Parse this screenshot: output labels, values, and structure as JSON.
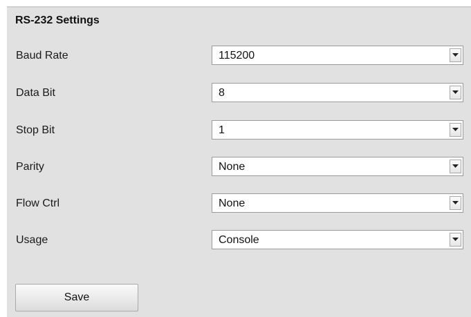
{
  "panel": {
    "title": "RS-232 Settings"
  },
  "fields": [
    {
      "label": "Baud Rate",
      "value": "115200"
    },
    {
      "label": "Data Bit",
      "value": "8"
    },
    {
      "label": "Stop Bit",
      "value": "1"
    },
    {
      "label": "Parity",
      "value": "None"
    },
    {
      "label": "Flow Ctrl",
      "value": "None"
    },
    {
      "label": "Usage",
      "value": "Console"
    }
  ],
  "actions": {
    "save_label": "Save"
  },
  "icons": {
    "dropdown": "chevron-down-icon"
  },
  "colors": {
    "panel_background": "#e1e1e1",
    "field_background": "#ffffff"
  }
}
